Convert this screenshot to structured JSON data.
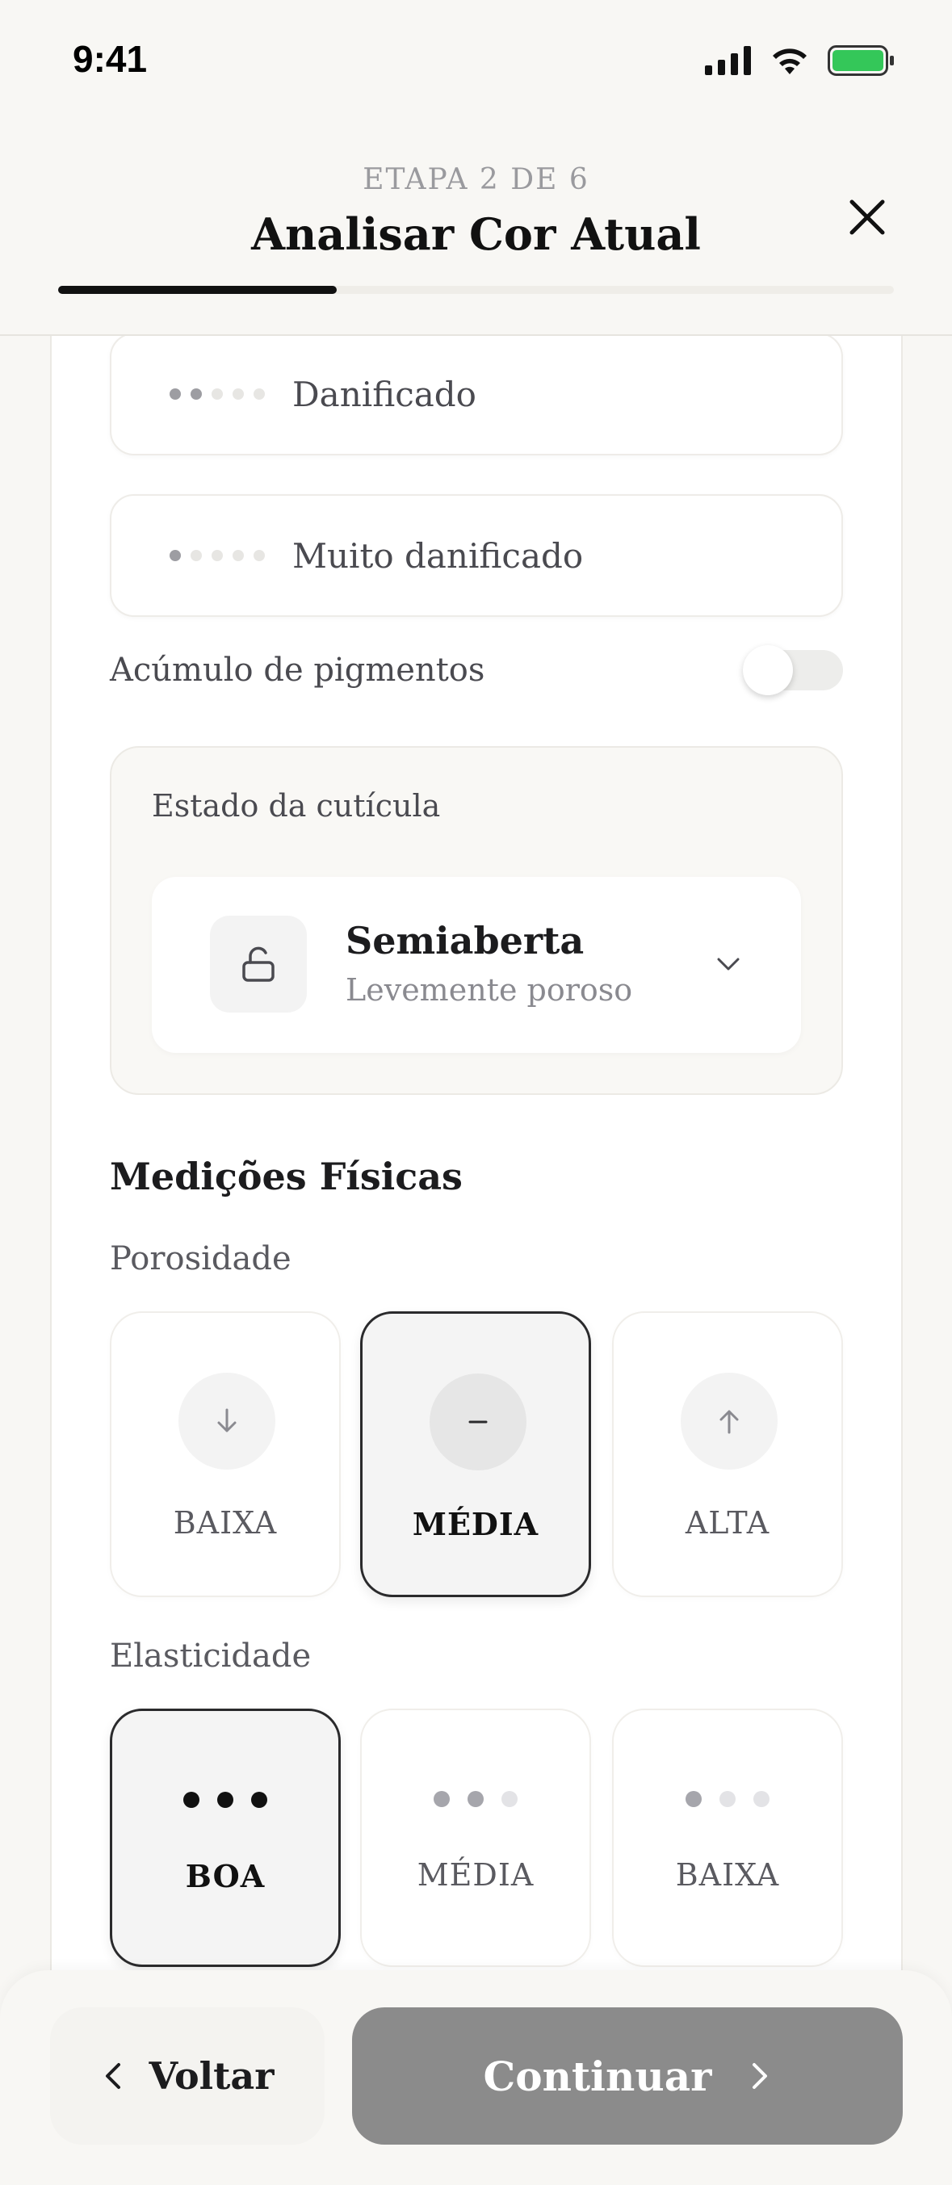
{
  "status_bar": {
    "time": "9:41"
  },
  "header": {
    "step_label": "ETAPA 2 DE 6",
    "title": "Analisar Cor Atual",
    "progress_fraction": 0.333
  },
  "damage_options": [
    {
      "label": "Danificado",
      "level": 2
    },
    {
      "label": "Muito danificado",
      "level": 1
    }
  ],
  "pigment_toggle": {
    "label": "Acúmulo de pigmentos",
    "on": false
  },
  "cuticle": {
    "title": "Estado da cutícula",
    "selected": "Semiaberta",
    "description": "Levemente poroso"
  },
  "physical": {
    "title": "Medições Físicas",
    "porosity": {
      "label": "Porosidade",
      "options": [
        {
          "label": "BAIXA",
          "icon": "arrow-down-icon"
        },
        {
          "label": "MÉDIA",
          "icon": "minus-icon",
          "selected": true
        },
        {
          "label": "ALTA",
          "icon": "arrow-up-icon"
        }
      ]
    },
    "elasticity": {
      "label": "Elasticidade",
      "options": [
        {
          "label": "BOA",
          "level": 3,
          "selected": true
        },
        {
          "label": "MÉDIA",
          "level": 2
        },
        {
          "label": "BAIXA",
          "level": 1
        }
      ]
    }
  },
  "footer": {
    "back_label": "Voltar",
    "continue_label": "Continuar"
  },
  "colors": {
    "accent": "#111111",
    "continue_bg": "#8b8b8b",
    "bg": "#f8f7f4"
  }
}
